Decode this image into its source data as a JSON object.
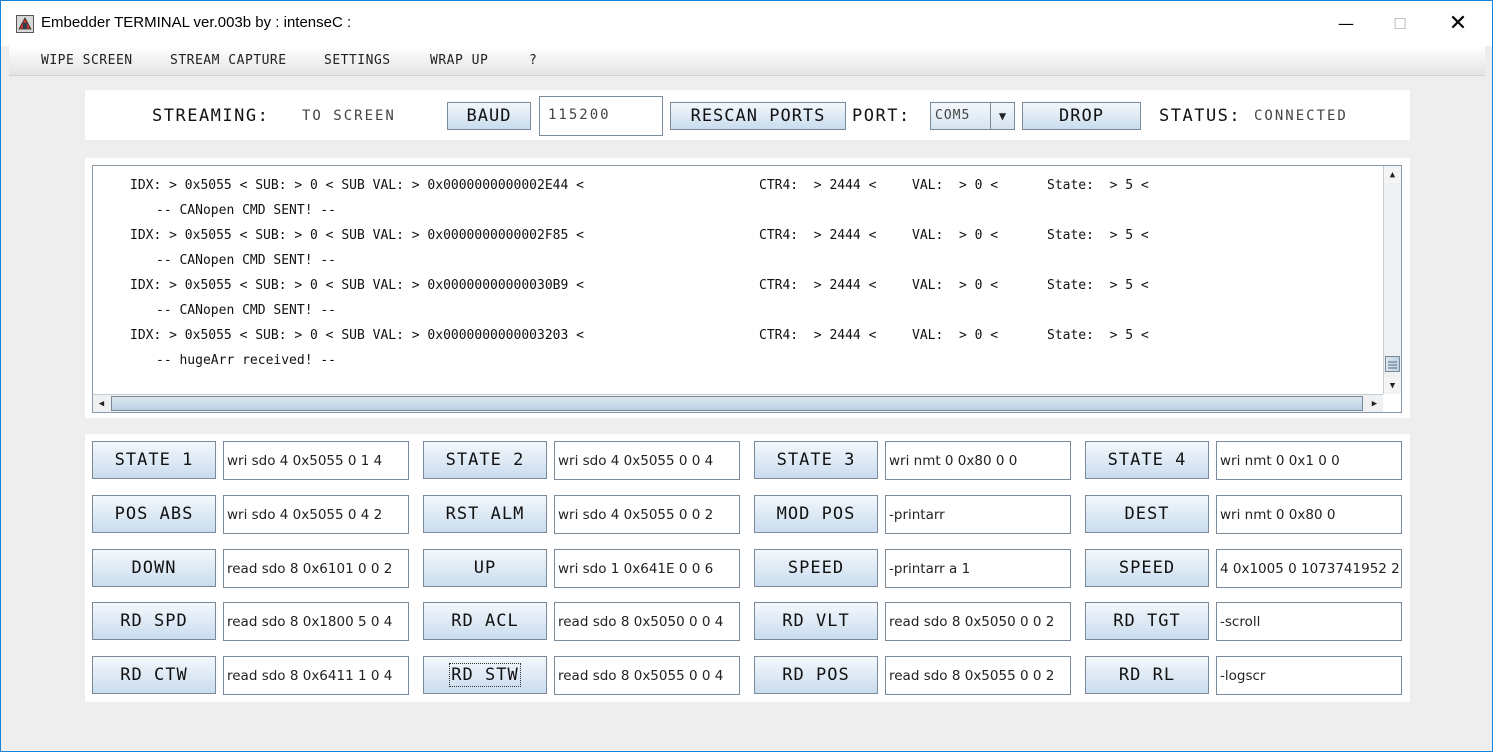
{
  "window": {
    "title": "Embedder TERMINAL ver.003b by : intenseC :",
    "minimize": "—",
    "maximize": "☐",
    "close": "✕"
  },
  "menu": [
    "WIPE SCREEN",
    "STREAM CAPTURE",
    "SETTINGS",
    "WRAP UP",
    "?"
  ],
  "top": {
    "streaming_label": "STREAMING:",
    "streaming_value": "TO SCREEN",
    "baud_button": "BAUD",
    "baud_value": "115200",
    "rescan_button": "RESCAN PORTS",
    "port_label": "PORT:",
    "port_value": "COM5",
    "drop_button": "DROP",
    "status_label": "STATUS:",
    "status_value": "CONNECTED"
  },
  "console": [
    {
      "kind": "data",
      "idx": "IDX: > 0x5055 < SUB: > 0 < SUB VAL: > 0x0000000000002E44 <",
      "ctr": "CTR4:  > 2444 <",
      "val": "VAL:  > 0 <",
      "state": "State:  > 5 <"
    },
    {
      "kind": "msg",
      "text": "-- CANopen CMD SENT! --"
    },
    {
      "kind": "data",
      "idx": "IDX: > 0x5055 < SUB: > 0 < SUB VAL: > 0x0000000000002F85 <",
      "ctr": "CTR4:  > 2444 <",
      "val": "VAL:  > 0 <",
      "state": "State:  > 5 <"
    },
    {
      "kind": "msg",
      "text": "-- CANopen CMD SENT! --"
    },
    {
      "kind": "data",
      "idx": "IDX: > 0x5055 < SUB: > 0 < SUB VAL: > 0x00000000000030B9 <",
      "ctr": "CTR4:  > 2444 <",
      "val": "VAL:  > 0 <",
      "state": "State:  > 5 <"
    },
    {
      "kind": "msg",
      "text": "-- CANopen CMD SENT! --"
    },
    {
      "kind": "data",
      "idx": "IDX: > 0x5055 < SUB: > 0 < SUB VAL: > 0x0000000000003203 <",
      "ctr": "CTR4:  > 2444 <",
      "val": "VAL:  > 0 <",
      "state": "State:  > 5 <"
    },
    {
      "kind": "msg",
      "text": "-- hugeArr received! --"
    }
  ],
  "scroll_icons": {
    "up": "▲",
    "down": "▼",
    "left": "◀",
    "right": "▶",
    "thumb": "grip-icon"
  },
  "commands": [
    [
      {
        "button": "STATE 1",
        "value": "wri sdo 4 0x5055 0 1 4"
      },
      {
        "button": "STATE 2",
        "value": "wri sdo 4 0x5055 0 0 4"
      },
      {
        "button": "STATE 3",
        "value": "wri nmt 0 0x80 0 0"
      },
      {
        "button": "STATE 4",
        "value": "wri nmt 0 0x1 0 0"
      }
    ],
    [
      {
        "button": "POS ABS",
        "value": "wri sdo 4 0x5055 0 4 2"
      },
      {
        "button": "RST ALM",
        "value": "wri sdo 4 0x5055 0 0 2"
      },
      {
        "button": "MOD POS",
        "value": "-printarr"
      },
      {
        "button": "DEST",
        "value": "wri nmt 0 0x80 0"
      }
    ],
    [
      {
        "button": "DOWN",
        "value": "read sdo 8 0x6101 0 0 2"
      },
      {
        "button": "UP",
        "value": "wri sdo 1 0x641E 0 0 6"
      },
      {
        "button": "SPEED",
        "value": "-printarr a 1"
      },
      {
        "button": "SPEED",
        "value": "4 0x1005 0 1073741952 2"
      }
    ],
    [
      {
        "button": "RD SPD",
        "value": "read sdo 8 0x1800 5 0 4"
      },
      {
        "button": "RD ACL",
        "value": "read sdo 8 0x5050 0 0 4"
      },
      {
        "button": "RD VLT",
        "value": "read sdo 8 0x5050 0 0 2"
      },
      {
        "button": "RD TGT",
        "value": "-scroll"
      }
    ],
    [
      {
        "button": "RD CTW",
        "value": "read sdo 8 0x6411 1 0 4"
      },
      {
        "button": "RD STW",
        "value": "read sdo 8 0x5055 0 0 4"
      },
      {
        "button": "RD POS",
        "value": "read sdo 8 0x5055 0 0 2"
      },
      {
        "button": "RD RL",
        "value": "-logscr"
      }
    ]
  ]
}
